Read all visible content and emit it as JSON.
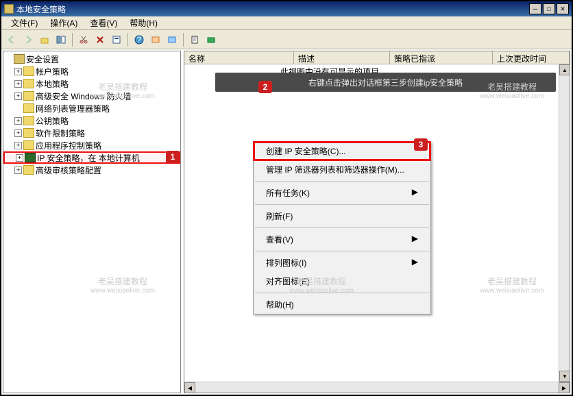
{
  "window": {
    "title": "本地安全策略"
  },
  "menubar": {
    "file": "文件(F)",
    "action": "操作(A)",
    "view": "查看(V)",
    "help": "帮助(H)"
  },
  "tree": {
    "root": "安全设置",
    "items": [
      "帐户策略",
      "本地策略",
      "高级安全 Windows 防火墙",
      "网络列表管理器策略",
      "公钥策略",
      "软件限制策略",
      "应用程序控制策略",
      "IP 安全策略，在 本地计算机",
      "高级审核策略配置"
    ]
  },
  "listhead": {
    "name": "名称",
    "desc": "描述",
    "assigned": "策略已指派",
    "lastmod": "上次更改时间"
  },
  "tooltip": {
    "hint_top": "此视图中没有可显示的项目。",
    "overlay": "右键点击弹出对话框第三步创建ip安全策略"
  },
  "context_menu": {
    "create_ip": "创建 IP 安全策略(C)...",
    "manage_filters": "管理 IP 筛选器列表和筛选器操作(M)...",
    "all_tasks": "所有任务(K)",
    "refresh": "刷新(F)",
    "view": "查看(V)",
    "arrange_icons": "排列图标(I)",
    "align_icons": "对齐图标(E)",
    "help": "帮助(H)"
  },
  "badges": {
    "b1": "1",
    "b2": "2",
    "b3": "3"
  },
  "watermark": {
    "text": "老吴搭建教程",
    "url": "www.weixiaolive.com"
  }
}
